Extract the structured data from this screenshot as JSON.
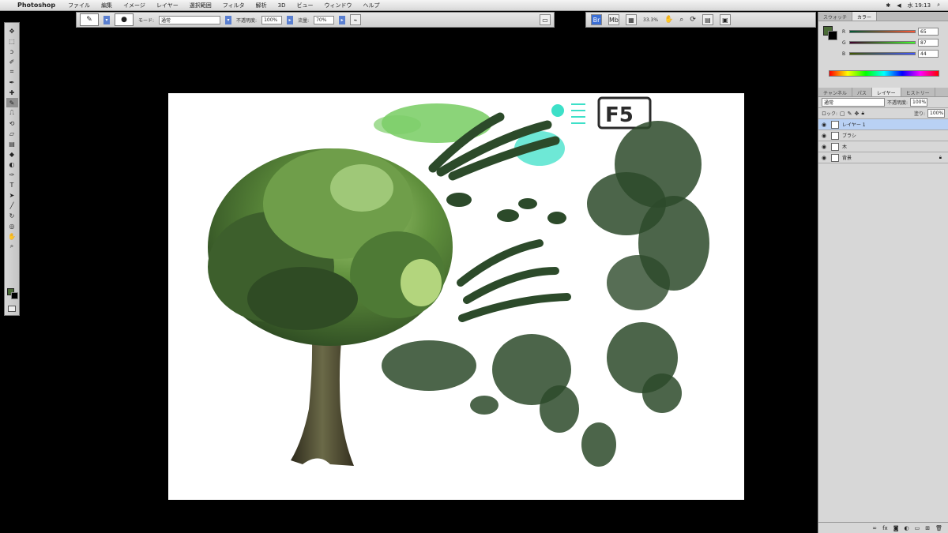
{
  "menubar": {
    "app_name": "Photoshop",
    "items": [
      "ファイル",
      "編集",
      "イメージ",
      "レイヤー",
      "選択範囲",
      "フィルタ",
      "解析",
      "3D",
      "ビュー",
      "ウィンドウ",
      "ヘルプ"
    ],
    "clock": "水 19:13"
  },
  "options": {
    "mode_label": "モード:",
    "mode_value": "通常",
    "opacity_label": "不透明度:",
    "opacity_value": "100%",
    "flow_label": "流量:",
    "flow_value": "70%"
  },
  "app_bar": {
    "zoom": "33.3%"
  },
  "color_panel": {
    "tabs": [
      "スウォッチ",
      "カラー"
    ],
    "channels": [
      {
        "label": "R",
        "value": "65",
        "color": "#4a6b36"
      },
      {
        "label": "G",
        "value": "87",
        "color": "#4a6b36"
      },
      {
        "label": "B",
        "value": "44",
        "color": "#4a6b36"
      }
    ]
  },
  "layers_panel": {
    "tabs": [
      "チャンネル",
      "パス",
      "レイヤー",
      "ヒストリー"
    ],
    "blend_mode": "通常",
    "opacity_label": "不透明度:",
    "opacity_value": "100%",
    "lock_label": "ロック:",
    "fill_label": "塗り:",
    "fill_value": "100%",
    "layers": [
      {
        "name": "レイヤー 1",
        "selected": true
      },
      {
        "name": "ブラシ",
        "selected": false
      },
      {
        "name": "木",
        "selected": false
      },
      {
        "name": "背景",
        "selected": false
      }
    ]
  },
  "canvas": {
    "annotation_text": "F5"
  }
}
